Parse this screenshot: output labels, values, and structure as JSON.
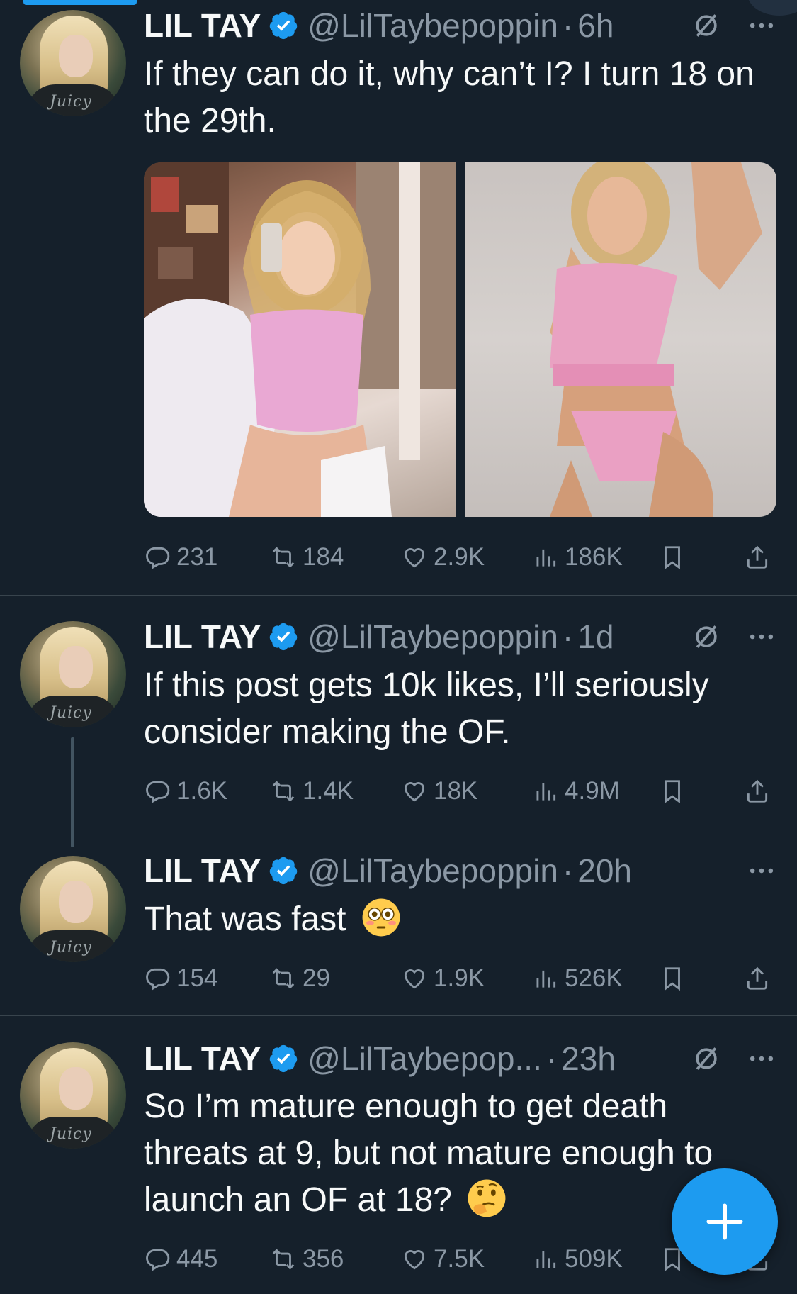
{
  "tweets": [
    {
      "name": "LIL TAY",
      "handle": "@LilTaybepoppin",
      "time": "6h",
      "text": "If they can do it, why can’t I? I turn 18 on the 29th.",
      "stats": {
        "replies": "231",
        "reposts": "184",
        "likes": "2.9K",
        "views": "186K"
      }
    },
    {
      "name": "LIL TAY",
      "handle": "@LilTaybepoppin",
      "time": "1d",
      "text": "If this post gets 10k likes, I’ll seriously consider making the OF.",
      "stats": {
        "replies": "1.6K",
        "reposts": "1.4K",
        "likes": "18K",
        "views": "4.9M"
      }
    },
    {
      "name": "LIL TAY",
      "handle": "@LilTaybepoppin",
      "time": "20h",
      "text": "That was fast",
      "emoji": "flushed-face",
      "stats": {
        "replies": "154",
        "reposts": "29",
        "likes": "1.9K",
        "views": "526K"
      }
    },
    {
      "name": "LIL TAY",
      "handle": "@LilTaybepop...",
      "time": "23h",
      "text": "So I’m mature enough to get death threats at 9, but not mature enough to launch an OF at 18?",
      "emoji": "thinking-face",
      "stats": {
        "replies": "445",
        "reposts": "356",
        "likes": "7.5K",
        "views": "509K"
      }
    }
  ],
  "avatar_shirt_text": "Juicy",
  "dot": "·",
  "colors": {
    "background": "#15202b",
    "accent": "#1d9bf0",
    "secondary_text": "#8b98a5",
    "divider": "#38444d"
  },
  "icons": [
    "verified-badge-icon",
    "mute-icon",
    "more-icon",
    "reply-icon",
    "repost-icon",
    "like-icon",
    "views-icon",
    "bookmark-icon",
    "share-icon",
    "compose-plus-icon"
  ]
}
